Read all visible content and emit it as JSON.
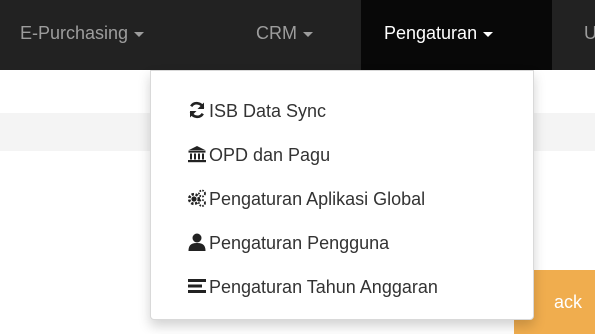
{
  "navbar": {
    "items": [
      {
        "label": "E-Purchasing"
      },
      {
        "label": "CRM"
      },
      {
        "label": "Pengaturan"
      },
      {
        "label": "U"
      }
    ]
  },
  "dropdown": {
    "items": [
      {
        "label": "ISB Data Sync",
        "icon": "refresh-icon"
      },
      {
        "label": "OPD dan Pagu",
        "icon": "institution-icon"
      },
      {
        "label": "Pengaturan Aplikasi Global",
        "icon": "cogs-icon"
      },
      {
        "label": "Pengaturan Pengguna",
        "icon": "user-icon"
      },
      {
        "label": "Pengaturan Tahun Anggaran",
        "icon": "list-icon"
      }
    ]
  },
  "page": {
    "back_button_label": "ack"
  },
  "colors": {
    "navbar_bg": "#222222",
    "navbar_active_bg": "#080808",
    "navbar_text": "#9d9d9d",
    "warning": "#f0ad4e"
  }
}
